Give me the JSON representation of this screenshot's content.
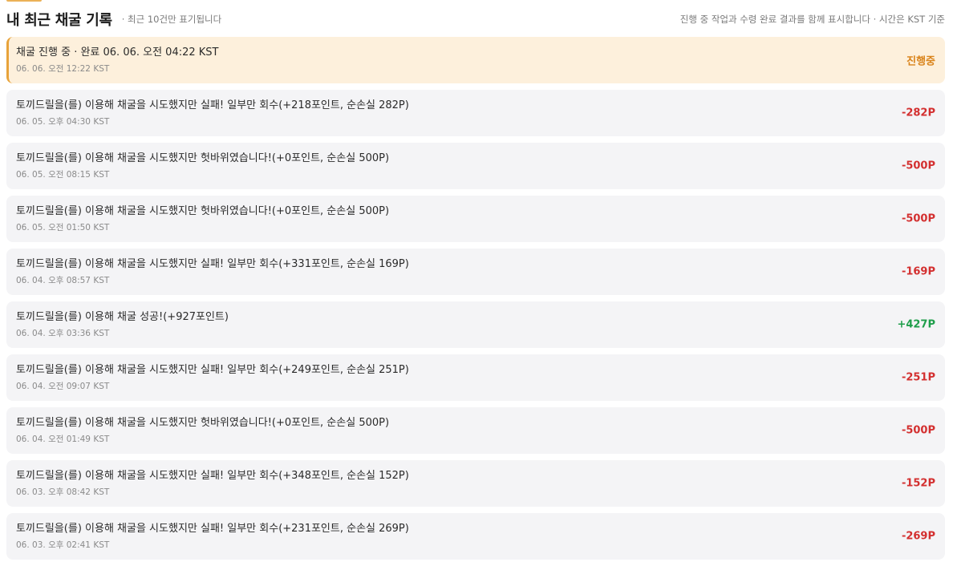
{
  "header": {
    "title": "내 최근 채굴 기록",
    "subtitle": "· 최근 10건만 표기됩니다",
    "note": "진행 중 작업과 수령 완료 결과를 함께 표시합니다 · 시간은 KST 기준"
  },
  "colors": {
    "accent": "#e8a33a",
    "negative": "#d32f2f",
    "positive": "#1e9e4a",
    "pending": "#d9831a"
  },
  "records": [
    {
      "text": "채굴 진행 중 · 완료 06. 06. 오전 04:22 KST",
      "time": "06. 06. 오전 12:22 KST",
      "amount": "진행중",
      "kind": "pending",
      "active": true
    },
    {
      "text": "토끼드릴을(를) 이용해 채굴을 시도했지만 실패! 일부만 회수(+218포인트, 순손실 282P)",
      "time": "06. 05. 오후 04:30 KST",
      "amount": "-282P",
      "kind": "negative",
      "active": false
    },
    {
      "text": "토끼드릴을(를) 이용해 채굴을 시도했지만 헛바위였습니다!(+0포인트, 순손실 500P)",
      "time": "06. 05. 오전 08:15 KST",
      "amount": "-500P",
      "kind": "negative",
      "active": false
    },
    {
      "text": "토끼드릴을(를) 이용해 채굴을 시도했지만 헛바위였습니다!(+0포인트, 순손실 500P)",
      "time": "06. 05. 오전 01:50 KST",
      "amount": "-500P",
      "kind": "negative",
      "active": false
    },
    {
      "text": "토끼드릴을(를) 이용해 채굴을 시도했지만 실패! 일부만 회수(+331포인트, 순손실 169P)",
      "time": "06. 04. 오후 08:57 KST",
      "amount": "-169P",
      "kind": "negative",
      "active": false
    },
    {
      "text": "토끼드릴을(를) 이용해 채굴 성공!(+927포인트)",
      "time": "06. 04. 오후 03:36 KST",
      "amount": "+427P",
      "kind": "positive",
      "active": false
    },
    {
      "text": "토끼드릴을(를) 이용해 채굴을 시도했지만 실패! 일부만 회수(+249포인트, 순손실 251P)",
      "time": "06. 04. 오전 09:07 KST",
      "amount": "-251P",
      "kind": "negative",
      "active": false
    },
    {
      "text": "토끼드릴을(를) 이용해 채굴을 시도했지만 헛바위였습니다!(+0포인트, 순손실 500P)",
      "time": "06. 04. 오전 01:49 KST",
      "amount": "-500P",
      "kind": "negative",
      "active": false
    },
    {
      "text": "토끼드릴을(를) 이용해 채굴을 시도했지만 실패! 일부만 회수(+348포인트, 순손실 152P)",
      "time": "06. 03. 오후 08:42 KST",
      "amount": "-152P",
      "kind": "negative",
      "active": false
    },
    {
      "text": "토끼드릴을(를) 이용해 채굴을 시도했지만 실패! 일부만 회수(+231포인트, 순손실 269P)",
      "time": "06. 03. 오후 02:41 KST",
      "amount": "-269P",
      "kind": "negative",
      "active": false
    }
  ]
}
